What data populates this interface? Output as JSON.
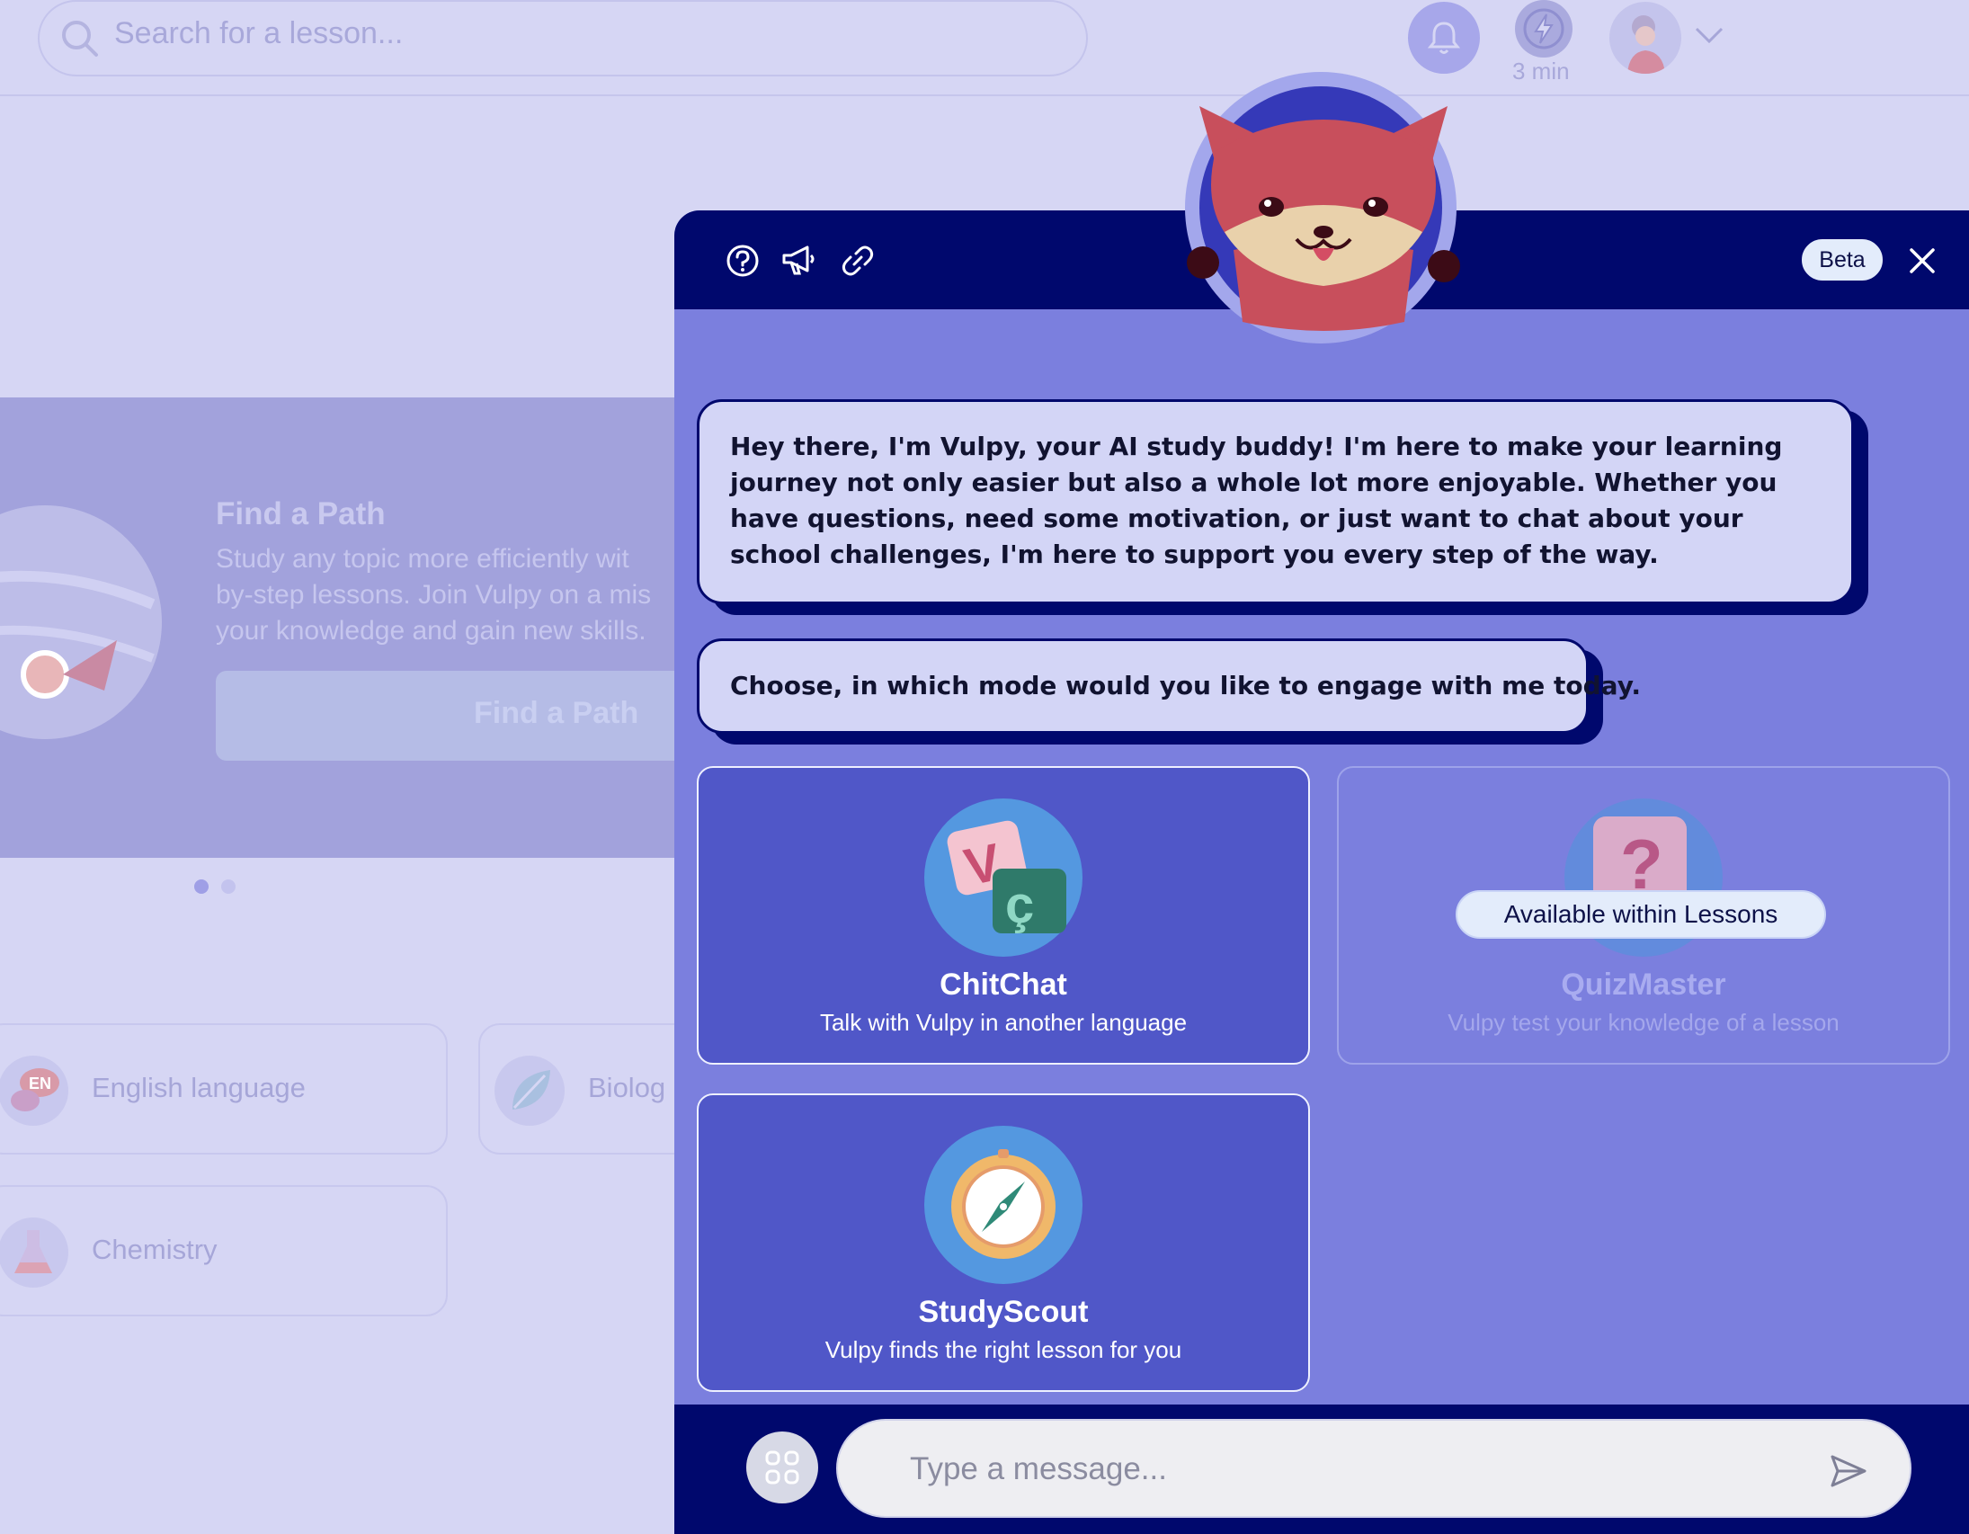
{
  "search": {
    "placeholder": "Search for a lesson..."
  },
  "header": {
    "timer_label": "3 min"
  },
  "banner": {
    "title": "Find a Path",
    "description_lines": [
      "Study any topic more efficiently wit",
      "by-step lessons. Join Vulpy on a mis",
      "your knowledge and gain new skills."
    ],
    "button_label": "Find a Path"
  },
  "subjects": [
    {
      "label": "English language",
      "icon": "en-speech-icon"
    },
    {
      "label": "Biolog",
      "icon": "leaf-icon"
    },
    {
      "label": "Chemistry",
      "icon": "flask-icon"
    }
  ],
  "chat": {
    "beta_label": "Beta",
    "messages": [
      "Hey there, I'm Vulpy, your AI study buddy! I'm here to make your learning journey not only easier but also a whole lot more enjoyable. Whether you have questions, need some motivation, or just want to chat about your school challenges, I'm here to support you every step of the way.",
      "Choose, in which mode would you like to engage with me today."
    ],
    "modes": [
      {
        "title": "ChitChat",
        "subtitle": "Talk with Vulpy in another language",
        "enabled": true
      },
      {
        "title": "QuizMaster",
        "subtitle": "Vulpy test your knowledge of a lesson",
        "enabled": false,
        "tooltip": "Available within Lessons"
      },
      {
        "title": "StudyScout",
        "subtitle": "Vulpy finds the right lesson for you",
        "enabled": true
      }
    ],
    "input_placeholder": "Type a message..."
  },
  "colors": {
    "panel_header": "#00086d",
    "panel_body": "#7b7fde",
    "mode_card": "#5057c8",
    "bubble": "#d3d5f6",
    "fox": "#c84f5c"
  }
}
